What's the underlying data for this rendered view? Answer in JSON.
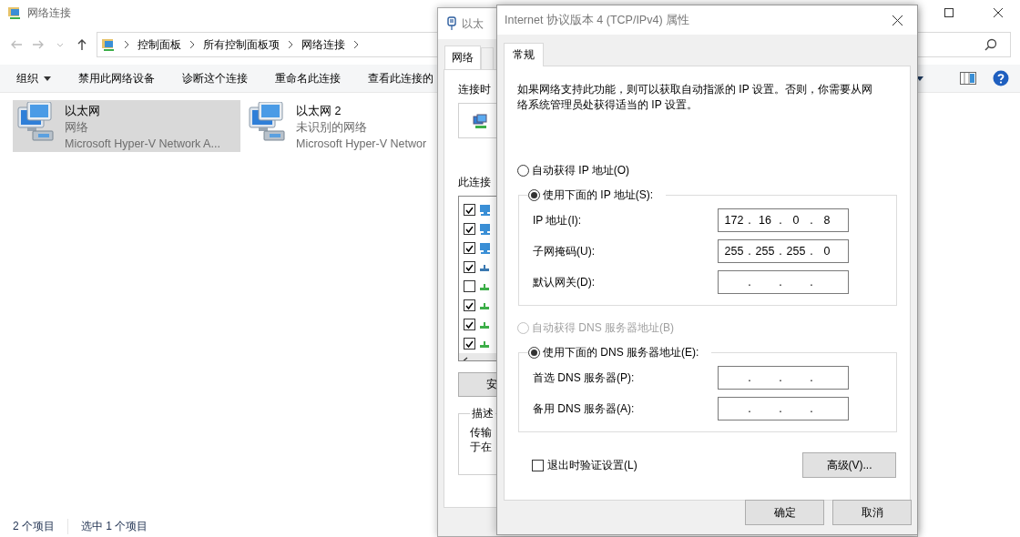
{
  "explorer": {
    "title": "网络连接",
    "breadcrumb": [
      "控制面板",
      "所有控制面板项",
      "网络连接"
    ],
    "toolbar": [
      {
        "label": "组织",
        "kind": "menu"
      },
      {
        "label": "禁用此网络设备",
        "kind": "button"
      },
      {
        "label": "诊断这个连接",
        "kind": "button"
      },
      {
        "label": "重命名此连接",
        "kind": "button"
      },
      {
        "label": "查看此连接的",
        "kind": "button"
      }
    ],
    "items": [
      {
        "name": "以太网",
        "status": "网络",
        "device": "Microsoft Hyper-V Network A...",
        "selected": true
      },
      {
        "name": "以太网 2",
        "status": "未识别的网络",
        "device": "Microsoft Hyper-V Networ",
        "selected": false
      }
    ],
    "status_bar": [
      "2 个项目",
      "选中 1 个项目"
    ]
  },
  "ethernet_dialog": {
    "title": "以太",
    "tabs": [
      {
        "label": "网络",
        "selected": true
      }
    ],
    "connect_label": "连接时",
    "components_label": "此连接",
    "components": [
      {
        "checked": true,
        "kind": "monitor",
        "color": "#3a8fd6"
      },
      {
        "checked": true,
        "kind": "monitor",
        "color": "#3a8fd6"
      },
      {
        "checked": true,
        "kind": "monitor",
        "color": "#3a8fd6"
      },
      {
        "checked": true,
        "kind": "protocol",
        "color": "#3a78b0"
      },
      {
        "checked": false,
        "kind": "protocol",
        "color": "#3cae48"
      },
      {
        "checked": true,
        "kind": "protocol",
        "color": "#3cae48"
      },
      {
        "checked": true,
        "kind": "protocol",
        "color": "#3cae48"
      },
      {
        "checked": true,
        "kind": "protocol",
        "color": "#3cae48"
      }
    ],
    "install_button": "安",
    "description_label": "描述",
    "description_lines": [
      "传输",
      "于在"
    ]
  },
  "ipv4_dialog": {
    "title": "Internet 协议版本 4 (TCP/IPv4) 属性",
    "tabs": [
      {
        "label": "常规",
        "selected": true
      }
    ],
    "intro": "如果网络支持此功能，则可以获取自动指派的 IP 设置。否则，你需要从网络系统管理员处获得适当的 IP 设置。",
    "ip_auto": {
      "label": "自动获得 IP 地址(O)",
      "selected": false,
      "disabled": false
    },
    "ip_manual": {
      "label": "使用下面的 IP 地址(S):",
      "selected": true,
      "disabled": false
    },
    "ip_fields": [
      {
        "label": "IP 地址(I):",
        "octets": [
          "172",
          "16",
          "0",
          "8"
        ],
        "dots": [
          ".",
          ".",
          "."
        ]
      },
      {
        "label": "子网掩码(U):",
        "octets": [
          "255",
          "255",
          "255",
          "0"
        ],
        "dots": [
          ".",
          ".",
          "."
        ]
      },
      {
        "label": "默认网关(D):",
        "dots": [
          ".",
          ".",
          "."
        ]
      }
    ],
    "dns_auto": {
      "label": "自动获得 DNS 服务器地址(B)",
      "selected": false,
      "disabled": true
    },
    "dns_manual": {
      "label": "使用下面的 DNS 服务器地址(E):",
      "selected": true,
      "disabled": false
    },
    "dns_fields": [
      {
        "label": "首选 DNS 服务器(P):",
        "dots": [
          ".",
          ".",
          "."
        ]
      },
      {
        "label": "备用 DNS 服务器(A):",
        "dots": [
          ".",
          ".",
          "."
        ]
      }
    ],
    "validate_on_exit": {
      "label": "退出时验证设置(L)",
      "checked": false
    },
    "advanced_button": "高级(V)...",
    "buttons": [
      "确定",
      "取消"
    ]
  }
}
